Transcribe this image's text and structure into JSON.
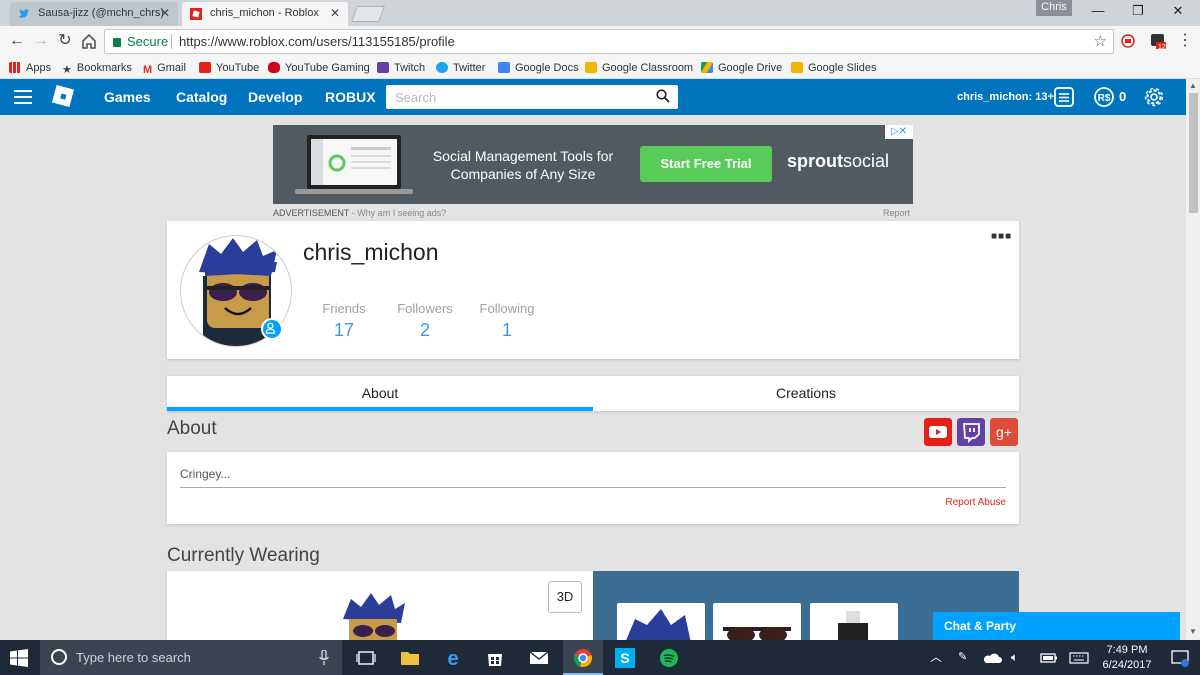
{
  "browser": {
    "tabs": [
      {
        "title": "Sausa-jizz (@mchn_chrs)",
        "icon": "twitter-icon"
      },
      {
        "title": "chris_michon - Roblox",
        "icon": "roblox-icon"
      }
    ],
    "profile_name": "Chris",
    "secure_label": "Secure",
    "url": "https://www.roblox.com/users/113155185/profile",
    "extension_badge": "12",
    "bookmarks": [
      "Apps",
      "Bookmarks",
      "Gmail",
      "YouTube",
      "YouTube Gaming",
      "Twitch",
      "Twitter",
      "Google Docs",
      "Google Classroom",
      "Google Drive",
      "Google Slides"
    ]
  },
  "nav": {
    "links": [
      "Games",
      "Catalog",
      "Develop",
      "ROBUX"
    ],
    "search_placeholder": "Search",
    "username": "chris_michon: 13+",
    "robux": "0",
    "accent": "#0074bd"
  },
  "ad": {
    "text": "Social Management Tools for Companies of Any Size",
    "button": "Start Free Trial",
    "brand_a": "sprout",
    "brand_b": "social",
    "caption": "ADVERTISEMENT",
    "caption_link": " - Why am I seeing ads?",
    "report": "Report"
  },
  "profile": {
    "name": "chris_michon",
    "more": "■■■",
    "stats": [
      {
        "label": "Friends",
        "value": "17"
      },
      {
        "label": "Followers",
        "value": "2"
      },
      {
        "label": "Following",
        "value": "1"
      }
    ]
  },
  "tabs": [
    "About",
    "Creations"
  ],
  "about": {
    "heading": "About",
    "bio": "Cringey...",
    "report_abuse": "Report Abuse",
    "social": [
      "youtube-icon",
      "twitch-icon",
      "google-plus-icon"
    ]
  },
  "wearing": {
    "heading": "Currently Wearing",
    "btn_3d": "3D"
  },
  "chat": {
    "label": "Chat & Party"
  },
  "taskbar": {
    "search_placeholder": "Type here to search",
    "time": "7:49 PM",
    "date": "6/24/2017"
  }
}
